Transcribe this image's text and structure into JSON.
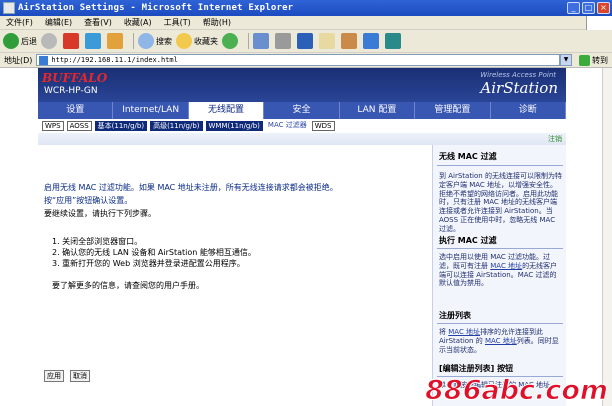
{
  "window": {
    "title": "AirStation Settings - Microsoft Internet Explorer",
    "buttons": [
      "_",
      "□",
      "×"
    ]
  },
  "menu": [
    "文件(F)",
    "编辑(E)",
    "查看(V)",
    "收藏(A)",
    "工具(T)",
    "帮助(H)"
  ],
  "toolbar": {
    "back": "后退",
    "search": "搜索",
    "favorites": "收藏夹"
  },
  "address": {
    "label": "地址(D)",
    "url": "http://192.168.11.1/index.html",
    "go": "转到"
  },
  "header": {
    "brand": "BUFFALO",
    "model": "WCR-HP-GN",
    "product_sub": "Wireless Access Point",
    "product": "AirStation"
  },
  "tabs": [
    "设置",
    "Internet/LAN",
    "无线配置",
    "安全",
    "LAN 配置",
    "管理配置",
    "诊断"
  ],
  "subtabs": [
    "WPS",
    "AOSS",
    "基本(11n/g/b)",
    "高级(11n/g/b)",
    "WMM(11n/g/b)",
    "MAC 过滤器",
    "WDS"
  ],
  "logout": "注销",
  "main": {
    "line1": "启用无线 MAC 过滤功能。如果 MAC 地址未注册，所有无线连接请求都会被拒绝。",
    "line2": "按“应用”按钮确认设置。",
    "line3": "要继续设置，请执行下列步骤。",
    "steps": [
      "1.  关闭全部浏览器窗口。",
      "2.  确认您的无线 LAN 设备和 AirStation 能够相互通信。",
      "3.  重新打开您的 Web 浏览器并登录进配置公用程序。"
    ],
    "more": "要了解更多的信息，请查阅您的用户手册。",
    "apply": "应用",
    "cancel": "取消"
  },
  "side": {
    "h1": "无线 MAC 过滤",
    "p1": "到 AirStation 的无线连接可以限制为特定客户端 MAC 地址，以增强安全性。拒绝不希望的网络访问者。启用此功能时，只有注册 MAC 地址的无线客户端连接或者允许连接到 AirStation。当 AOSS 正在使用中时，忽略无线 MAC 过滤。",
    "h2": "执行 MAC 过滤",
    "p2a": "选中启用以使用 MAC 过滤功能。过滤，既可有注册 ",
    "p2link": "MAC 地址",
    "p2b": "的无线客户端可以连接 AirStation。MAC 过滤的默认值为禁用。",
    "h3": "注册列表",
    "p3a": "将 ",
    "p3link1": "MAC 地址",
    "p3b": "排序的允许连接到此 AirStation 的 ",
    "p3link2": "MAC 地址",
    "p3c": "列表。同时显示当前状态。",
    "h4": "[编辑注册列表] 按钮",
    "p4": "单击此按钮编辑已注册的 MAC 地址"
  },
  "watermark": "886abc.com"
}
